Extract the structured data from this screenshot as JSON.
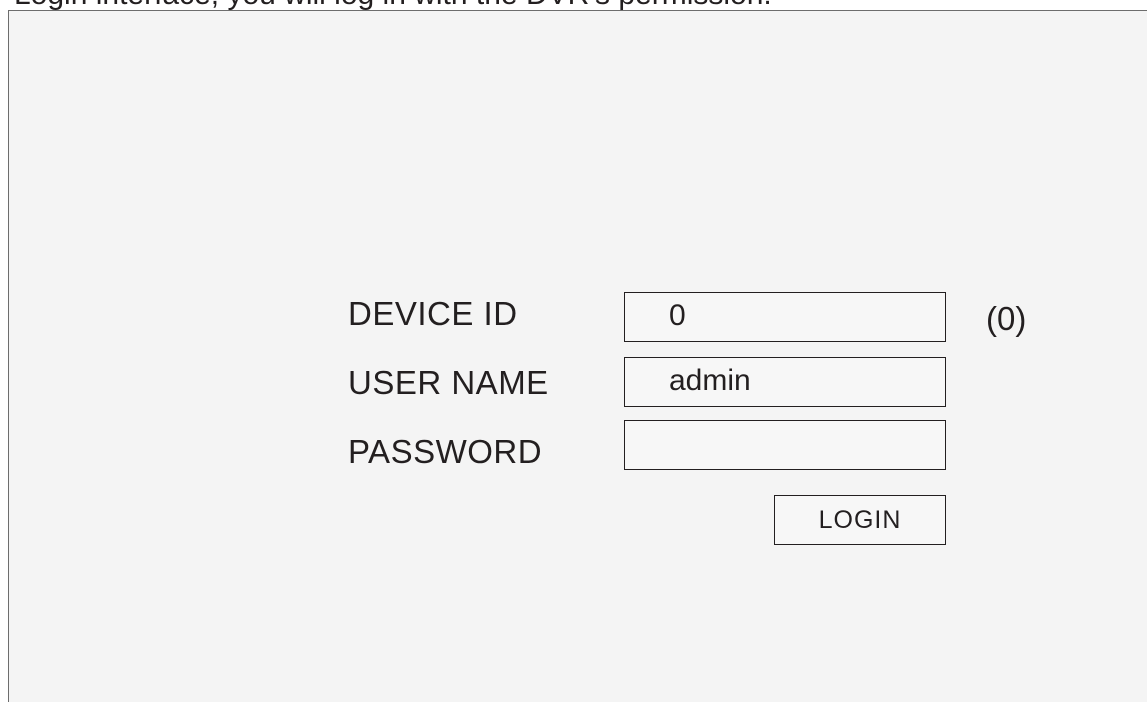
{
  "header": {
    "partial_text": "Login interface, you will log in with the DVR's permission."
  },
  "login_form": {
    "device_id": {
      "label": "DEVICE ID",
      "value": "0",
      "suffix": "(0)"
    },
    "user_name": {
      "label": "USER NAME",
      "value": "admin"
    },
    "password": {
      "label": "PASSWORD",
      "value": ""
    },
    "login_button": {
      "label": "LOGIN"
    }
  }
}
